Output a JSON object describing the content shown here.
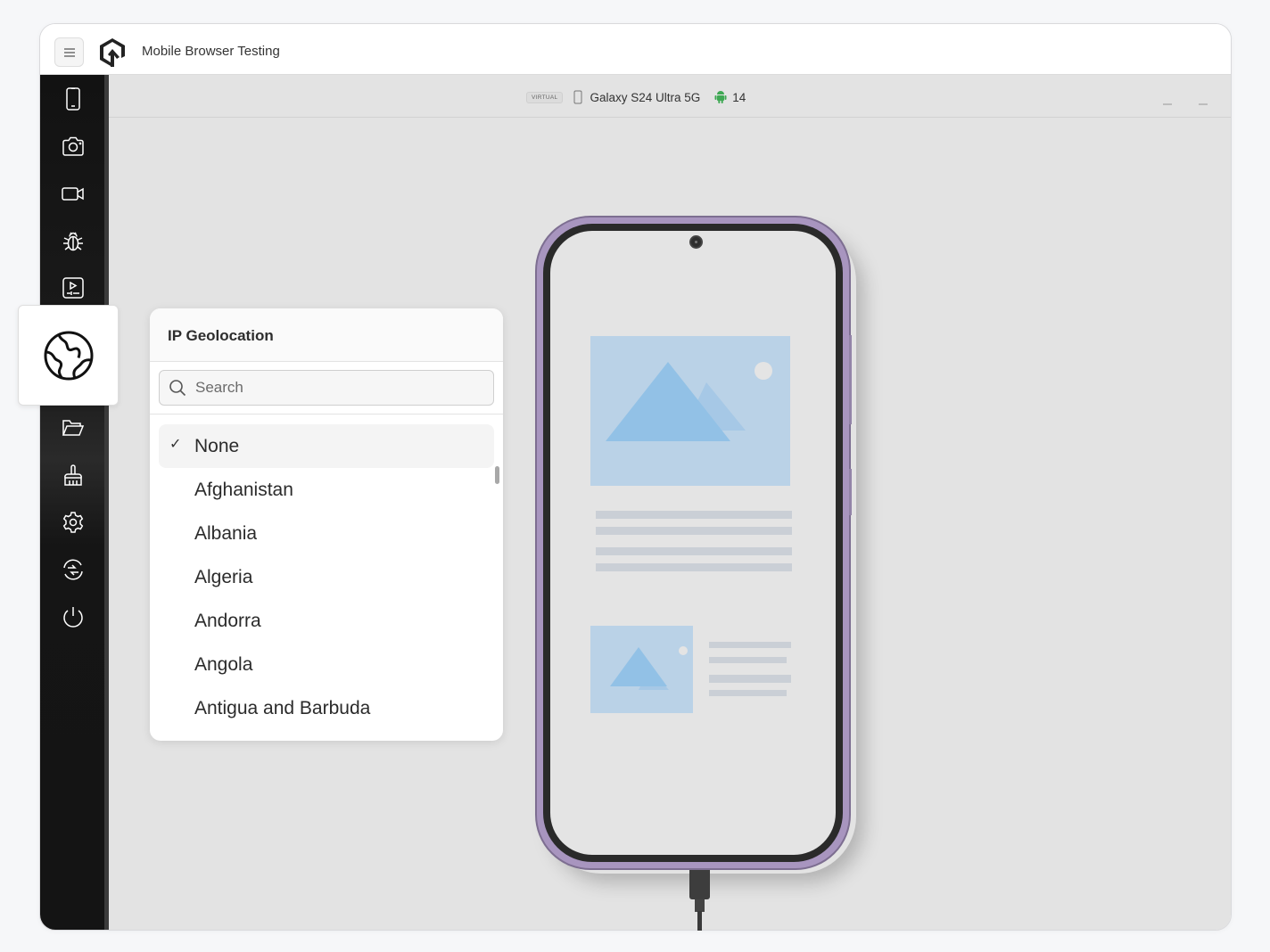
{
  "app": {
    "title": "Mobile Browser Testing",
    "menu_icon": "hamburger-icon",
    "logo_icon": "lambdatest-logo-icon"
  },
  "device": {
    "badge": "VIRTUAL",
    "name": "Galaxy S24 Ultra 5G",
    "device_icon": "phone-outline-icon",
    "os_icon": "android-icon",
    "os_version": "14",
    "os_color": "#3ea853"
  },
  "sidebar": {
    "items": [
      {
        "name": "switch-device",
        "icon": "mobile-device-icon"
      },
      {
        "name": "screenshot",
        "icon": "camera-icon"
      },
      {
        "name": "record-video",
        "icon": "video-camera-icon"
      },
      {
        "name": "debug",
        "icon": "bug-icon"
      },
      {
        "name": "media-playback",
        "icon": "play-tablet-icon"
      },
      {
        "name": "ip-geolocation",
        "icon": "globe-icon",
        "active": true
      },
      {
        "name": "file-upload",
        "icon": "folder-open-icon"
      },
      {
        "name": "clean-cache",
        "icon": "brush-icon"
      },
      {
        "name": "settings",
        "icon": "gear-icon"
      },
      {
        "name": "rotate-sync",
        "icon": "sync-arrows-icon"
      },
      {
        "name": "end-session",
        "icon": "power-icon"
      }
    ]
  },
  "geolocation": {
    "title": "IP Geolocation",
    "search_placeholder": "Search",
    "search_value": "",
    "selected": "None",
    "options": [
      "None",
      "Afghanistan",
      "Albania",
      "Algeria",
      "Andorra",
      "Angola",
      "Antigua and Barbuda"
    ]
  },
  "colors": {
    "phone_frame": "#a895bf",
    "sidebar_bg": "#121212",
    "canvas_bg": "#e3e3e3",
    "placeholder_image": "#bad2e7",
    "placeholder_mountain": "#92c1e6"
  }
}
